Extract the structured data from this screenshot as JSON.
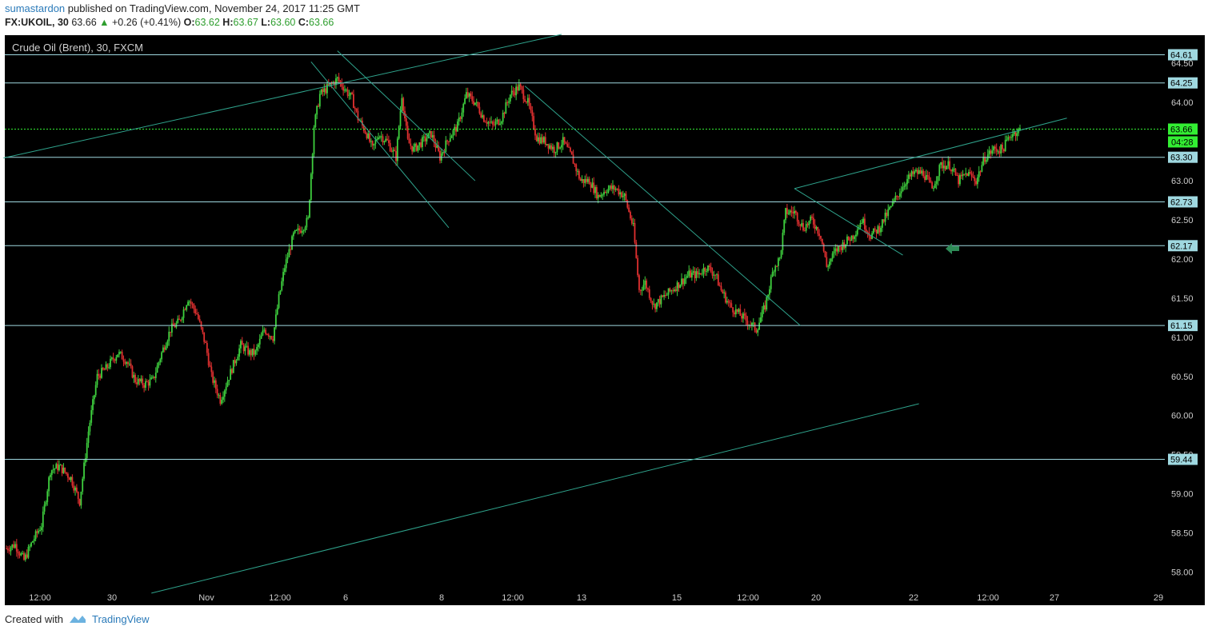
{
  "header": {
    "author": "sumastardon",
    "published_text": "published on TradingView.com, November 24, 2017 11:25 GMT",
    "symbol": "FX:UKOIL, 30",
    "last": "63.66",
    "change": "+0.26 (+0.41%)",
    "o_label": "O:",
    "o_val": "63.62",
    "h_label": "H:",
    "h_val": "63.67",
    "l_label": "L:",
    "l_val": "63.60",
    "c_label": "C:",
    "c_val": "63.66"
  },
  "chart_title": "Crude Oil (Brent), 30, FXCM",
  "footer": {
    "created_with": "Created with",
    "brand": "TradingView"
  },
  "colors": {
    "background": "#000000",
    "up": "#3ecf3e",
    "down": "#e03030",
    "hline": "#9fd8e0",
    "trend": "#2fa38c",
    "arrow": "#2e8b57",
    "last_price": "#33ee33"
  },
  "chart_data": {
    "type": "candlestick",
    "title": "Crude Oil (Brent), 30, FXCM",
    "y_ticks": [
      "64.50",
      "64.00",
      "63.50",
      "63.00",
      "62.50",
      "62.00",
      "61.50",
      "61.00",
      "60.50",
      "60.00",
      "59.50",
      "59.00",
      "58.50",
      "58.00"
    ],
    "x_ticks": [
      "12:00",
      "30",
      "Nov",
      "12:00",
      "6",
      "8",
      "12:00",
      "13",
      "15",
      "12:00",
      "20",
      "22",
      "12:00",
      "27",
      "29"
    ],
    "ylim": [
      57.78,
      64.86
    ],
    "last_price": {
      "value": "63.66",
      "countdown": "04:28"
    },
    "horizontal_levels": [
      "64.61",
      "64.25",
      "63.30",
      "62.73",
      "62.17",
      "61.15",
      "59.44"
    ],
    "path": [
      [
        0,
        58.3
      ],
      [
        6,
        58.35
      ],
      [
        12,
        58.15
      ],
      [
        18,
        58.4
      ],
      [
        24,
        58.6
      ],
      [
        30,
        59.3
      ],
      [
        36,
        59.35
      ],
      [
        44,
        59.2
      ],
      [
        50,
        58.9
      ],
      [
        56,
        59.8
      ],
      [
        62,
        60.5
      ],
      [
        68,
        60.6
      ],
      [
        76,
        60.8
      ],
      [
        82,
        60.7
      ],
      [
        88,
        60.45
      ],
      [
        94,
        60.4
      ],
      [
        100,
        60.45
      ],
      [
        106,
        60.8
      ],
      [
        112,
        61.1
      ],
      [
        118,
        61.2
      ],
      [
        124,
        61.5
      ],
      [
        130,
        61.3
      ],
      [
        136,
        60.9
      ],
      [
        140,
        60.5
      ],
      [
        146,
        60.2
      ],
      [
        150,
        60.4
      ],
      [
        156,
        60.7
      ],
      [
        160,
        60.9
      ],
      [
        166,
        60.8
      ],
      [
        170,
        60.8
      ],
      [
        176,
        61.1
      ],
      [
        182,
        61.0
      ],
      [
        186,
        61.5
      ],
      [
        190,
        61.9
      ],
      [
        196,
        62.3
      ],
      [
        202,
        62.4
      ],
      [
        206,
        62.5
      ],
      [
        210,
        63.7
      ],
      [
        214,
        64.1
      ],
      [
        220,
        64.2
      ],
      [
        226,
        64.3
      ],
      [
        230,
        64.2
      ],
      [
        236,
        64.05
      ],
      [
        240,
        63.8
      ],
      [
        246,
        63.6
      ],
      [
        250,
        63.4
      ],
      [
        254,
        63.6
      ],
      [
        260,
        63.5
      ],
      [
        266,
        63.3
      ],
      [
        270,
        64.1
      ],
      [
        274,
        63.5
      ],
      [
        278,
        63.4
      ],
      [
        284,
        63.5
      ],
      [
        290,
        63.6
      ],
      [
        296,
        63.3
      ],
      [
        302,
        63.55
      ],
      [
        308,
        63.7
      ],
      [
        314,
        64.1
      ],
      [
        320,
        64.0
      ],
      [
        326,
        63.8
      ],
      [
        332,
        63.7
      ],
      [
        338,
        63.8
      ],
      [
        344,
        64.1
      ],
      [
        350,
        64.2
      ],
      [
        356,
        64.0
      ],
      [
        362,
        63.55
      ],
      [
        368,
        63.5
      ],
      [
        374,
        63.4
      ],
      [
        380,
        63.5
      ],
      [
        386,
        63.3
      ],
      [
        392,
        63.0
      ],
      [
        398,
        63.0
      ],
      [
        404,
        62.8
      ],
      [
        410,
        62.9
      ],
      [
        416,
        62.9
      ],
      [
        422,
        62.8
      ],
      [
        428,
        62.4
      ],
      [
        432,
        61.6
      ],
      [
        436,
        61.7
      ],
      [
        442,
        61.4
      ],
      [
        448,
        61.5
      ],
      [
        454,
        61.6
      ],
      [
        460,
        61.7
      ],
      [
        466,
        61.8
      ],
      [
        472,
        61.8
      ],
      [
        478,
        61.9
      ],
      [
        484,
        61.8
      ],
      [
        488,
        61.6
      ],
      [
        494,
        61.4
      ],
      [
        500,
        61.3
      ],
      [
        506,
        61.2
      ],
      [
        512,
        61.1
      ],
      [
        518,
        61.4
      ],
      [
        524,
        61.9
      ],
      [
        528,
        62.0
      ],
      [
        532,
        62.6
      ],
      [
        538,
        62.6
      ],
      [
        544,
        62.4
      ],
      [
        550,
        62.5
      ],
      [
        556,
        62.3
      ],
      [
        560,
        61.9
      ],
      [
        566,
        62.1
      ],
      [
        572,
        62.2
      ],
      [
        578,
        62.3
      ],
      [
        584,
        62.5
      ],
      [
        590,
        62.3
      ],
      [
        596,
        62.4
      ],
      [
        602,
        62.6
      ],
      [
        608,
        62.8
      ],
      [
        614,
        63.0
      ],
      [
        620,
        63.1
      ],
      [
        626,
        63.1
      ],
      [
        632,
        62.9
      ],
      [
        638,
        63.2
      ],
      [
        644,
        63.2
      ],
      [
        650,
        63.0
      ],
      [
        656,
        63.1
      ],
      [
        662,
        63.0
      ],
      [
        668,
        63.3
      ],
      [
        674,
        63.4
      ],
      [
        680,
        63.4
      ],
      [
        686,
        63.6
      ],
      [
        692,
        63.65
      ]
    ]
  }
}
